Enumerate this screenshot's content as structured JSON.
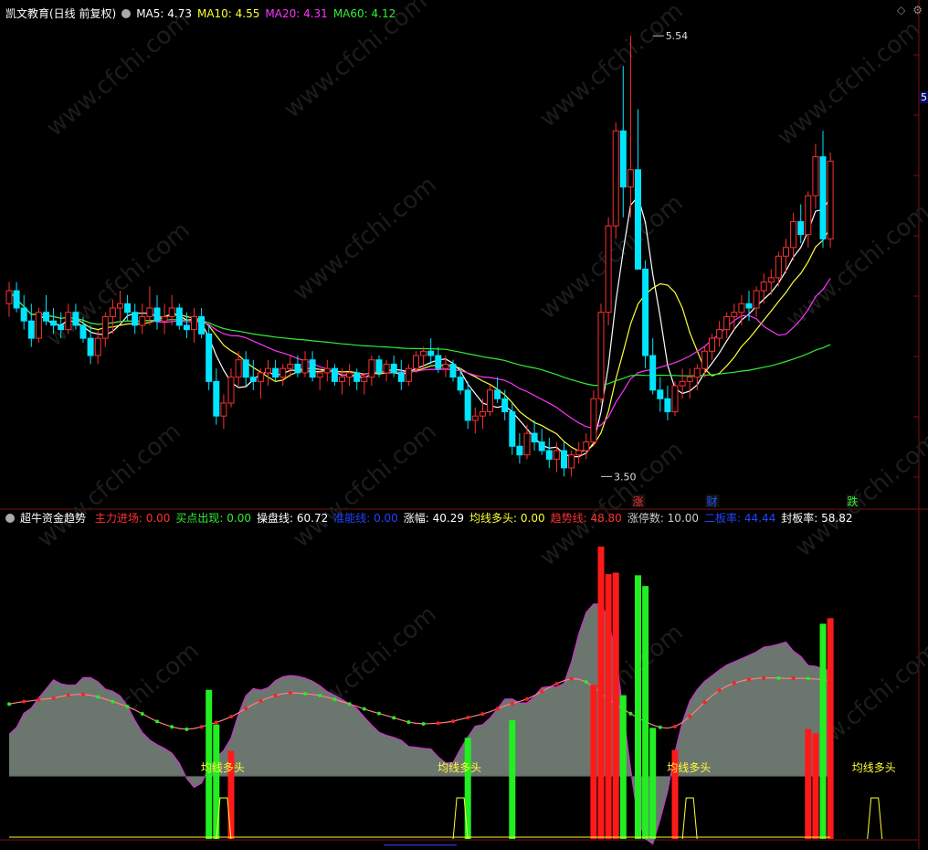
{
  "main_header": {
    "title": "凯文教育(日线 前复权)",
    "ma5_label": "MA5: 4.73",
    "ma10_label": "MA10: 4.55",
    "ma20_label": "MA20: 4.31",
    "ma60_label": "MA60: 4.12"
  },
  "indicator_header": {
    "name": "超牛资金趋势",
    "items": [
      {
        "text": "主力进场: 0.00",
        "color": "#ff3030"
      },
      {
        "text": "买点出现: 0.00",
        "color": "#33ee33"
      },
      {
        "text": "操盘线: 60.72",
        "color": "#ffffff"
      },
      {
        "text": "准能线: 0.00",
        "color": "#2244ff"
      },
      {
        "text": "涨幅: 40.29",
        "color": "#ffffff"
      },
      {
        "text": "均线多头: 0.00",
        "color": "#ffff33"
      },
      {
        "text": "趋势线: 48.80",
        "color": "#ff3030"
      },
      {
        "text": "涨停数: 10.00",
        "color": "#cccccc"
      },
      {
        "text": "二板率: 44.44",
        "color": "#2244ff"
      },
      {
        "text": "封板率: 58.82",
        "color": "#ffffff"
      }
    ]
  },
  "corner_icons": [
    "diamond-icon",
    "gear-icon"
  ],
  "edge_label": "5",
  "watermark": "www.cfchi.com",
  "colors": {
    "up": "#ff3030",
    "down": "#00e5ff",
    "ma5": "#ffffff",
    "ma10": "#ffff33",
    "ma20": "#ff33ff",
    "ma60": "#33ee33",
    "area": "#6b766f"
  },
  "chart_data": [
    {
      "type": "candlestick",
      "title": "凯文教育(日线 前复权)",
      "y_range": [
        3.4,
        5.6
      ],
      "annotations": [
        {
          "label": "5.54",
          "x_index": 87,
          "y": 5.54,
          "kind": "high"
        },
        {
          "label": "3.50",
          "x_index": 80,
          "y": 3.5,
          "kind": "low"
        }
      ],
      "event_markers": [
        {
          "label": "涨",
          "x_index": 85,
          "color": "#ff3030"
        },
        {
          "label": "财",
          "x_index": 95,
          "color": "#2255ff"
        },
        {
          "label": "跌",
          "x_index": 114,
          "color": "#33ee33"
        }
      ],
      "ohlc": [
        [
          4.3,
          4.4,
          4.24,
          4.36
        ],
        [
          4.36,
          4.4,
          4.26,
          4.28
        ],
        [
          4.28,
          4.34,
          4.18,
          4.22
        ],
        [
          4.22,
          4.3,
          4.1,
          4.14
        ],
        [
          4.14,
          4.28,
          4.12,
          4.26
        ],
        [
          4.26,
          4.34,
          4.2,
          4.22
        ],
        [
          4.22,
          4.28,
          4.16,
          4.2
        ],
        [
          4.2,
          4.26,
          4.14,
          4.18
        ],
        [
          4.18,
          4.3,
          4.16,
          4.26
        ],
        [
          4.26,
          4.3,
          4.18,
          4.2
        ],
        [
          4.2,
          4.24,
          4.12,
          4.14
        ],
        [
          4.14,
          4.2,
          4.02,
          4.06
        ],
        [
          4.06,
          4.18,
          4.02,
          4.14
        ],
        [
          4.14,
          4.26,
          4.1,
          4.24
        ],
        [
          4.24,
          4.32,
          4.16,
          4.28
        ],
        [
          4.28,
          4.36,
          4.22,
          4.3
        ],
        [
          4.3,
          4.34,
          4.22,
          4.26
        ],
        [
          4.26,
          4.3,
          4.16,
          4.2
        ],
        [
          4.2,
          4.3,
          4.16,
          4.24
        ],
        [
          4.24,
          4.38,
          4.2,
          4.28
        ],
        [
          4.28,
          4.34,
          4.18,
          4.22
        ],
        [
          4.22,
          4.3,
          4.16,
          4.24
        ],
        [
          4.24,
          4.34,
          4.2,
          4.28
        ],
        [
          4.28,
          4.3,
          4.18,
          4.2
        ],
        [
          4.2,
          4.26,
          4.14,
          4.18
        ],
        [
          4.18,
          4.28,
          4.12,
          4.24
        ],
        [
          4.24,
          4.28,
          4.14,
          4.16
        ],
        [
          4.16,
          4.2,
          3.9,
          3.94
        ],
        [
          3.94,
          4.0,
          3.74,
          3.78
        ],
        [
          3.78,
          3.88,
          3.72,
          3.84
        ],
        [
          3.84,
          4.0,
          3.82,
          3.96
        ],
        [
          3.96,
          4.08,
          3.92,
          4.04
        ],
        [
          4.04,
          4.08,
          3.92,
          3.96
        ],
        [
          3.96,
          4.04,
          3.9,
          3.94
        ],
        [
          3.94,
          4.0,
          3.86,
          3.98
        ],
        [
          3.98,
          4.04,
          3.92,
          4.0
        ],
        [
          4.0,
          4.04,
          3.94,
          3.96
        ],
        [
          3.96,
          4.02,
          3.92,
          4.0
        ],
        [
          4.0,
          4.06,
          3.96,
          4.02
        ],
        [
          4.02,
          4.06,
          3.96,
          3.98
        ],
        [
          3.98,
          4.08,
          3.96,
          4.04
        ],
        [
          4.04,
          4.08,
          3.94,
          3.96
        ],
        [
          3.96,
          4.0,
          3.9,
          3.98
        ],
        [
          3.98,
          4.04,
          3.94,
          4.0
        ],
        [
          4.0,
          4.02,
          3.92,
          3.94
        ],
        [
          3.94,
          4.0,
          3.88,
          3.96
        ],
        [
          3.96,
          4.02,
          3.92,
          3.98
        ],
        [
          3.98,
          4.0,
          3.9,
          3.94
        ],
        [
          3.94,
          3.98,
          3.88,
          3.96
        ],
        [
          3.96,
          4.06,
          3.92,
          4.04
        ],
        [
          4.04,
          4.06,
          3.96,
          3.98
        ],
        [
          3.98,
          4.04,
          3.94,
          4.02
        ],
        [
          4.02,
          4.06,
          3.96,
          3.98
        ],
        [
          3.98,
          4.04,
          3.9,
          3.94
        ],
        [
          3.94,
          4.02,
          3.92,
          4.0
        ],
        [
          4.0,
          4.08,
          3.98,
          4.06
        ],
        [
          4.06,
          4.1,
          4.0,
          4.08
        ],
        [
          4.08,
          4.14,
          4.02,
          4.06
        ],
        [
          4.06,
          4.1,
          3.98,
          4.0
        ],
        [
          4.0,
          4.06,
          3.96,
          4.02
        ],
        [
          4.02,
          4.04,
          3.94,
          3.96
        ],
        [
          3.96,
          4.0,
          3.88,
          3.9
        ],
        [
          3.9,
          3.94,
          3.72,
          3.76
        ],
        [
          3.76,
          3.82,
          3.7,
          3.78
        ],
        [
          3.78,
          3.86,
          3.72,
          3.8
        ],
        [
          3.8,
          3.92,
          3.78,
          3.9
        ],
        [
          3.9,
          3.96,
          3.84,
          3.86
        ],
        [
          3.86,
          3.9,
          3.76,
          3.8
        ],
        [
          3.8,
          3.84,
          3.6,
          3.64
        ],
        [
          3.64,
          3.7,
          3.56,
          3.6
        ],
        [
          3.6,
          3.74,
          3.58,
          3.7
        ],
        [
          3.7,
          3.76,
          3.62,
          3.66
        ],
        [
          3.66,
          3.72,
          3.6,
          3.62
        ],
        [
          3.62,
          3.68,
          3.54,
          3.58
        ],
        [
          3.58,
          3.66,
          3.52,
          3.62
        ],
        [
          3.62,
          3.66,
          3.5,
          3.54
        ],
        [
          3.54,
          3.62,
          3.5,
          3.6
        ],
        [
          3.6,
          3.66,
          3.56,
          3.62
        ],
        [
          3.62,
          3.7,
          3.58,
          3.66
        ],
        [
          3.66,
          3.9,
          3.64,
          3.86
        ],
        [
          3.86,
          4.3,
          3.84,
          4.26
        ],
        [
          4.26,
          4.7,
          4.2,
          4.66
        ],
        [
          4.66,
          5.14,
          4.6,
          5.1
        ],
        [
          5.1,
          5.4,
          4.7,
          4.84
        ],
        [
          4.84,
          5.54,
          4.7,
          4.92
        ],
        [
          4.92,
          5.2,
          4.46,
          4.46
        ],
        [
          4.46,
          4.5,
          4.0,
          4.06
        ],
        [
          4.06,
          4.14,
          3.88,
          3.9
        ],
        [
          3.9,
          3.96,
          3.8,
          3.86
        ],
        [
          3.86,
          3.92,
          3.76,
          3.8
        ],
        [
          3.8,
          3.94,
          3.78,
          3.92
        ],
        [
          3.92,
          4.0,
          3.86,
          3.94
        ],
        [
          3.94,
          4.0,
          3.86,
          3.96
        ],
        [
          3.96,
          4.02,
          3.9,
          4.0
        ],
        [
          4.0,
          4.1,
          3.96,
          4.08
        ],
        [
          4.08,
          4.16,
          4.04,
          4.14
        ],
        [
          4.14,
          4.22,
          4.1,
          4.18
        ],
        [
          4.18,
          4.26,
          4.14,
          4.24
        ],
        [
          4.24,
          4.3,
          4.18,
          4.26
        ],
        [
          4.26,
          4.34,
          4.2,
          4.3
        ],
        [
          4.3,
          4.36,
          4.22,
          4.28
        ],
        [
          4.28,
          4.38,
          4.24,
          4.36
        ],
        [
          4.36,
          4.44,
          4.3,
          4.4
        ],
        [
          4.4,
          4.46,
          4.34,
          4.42
        ],
        [
          4.42,
          4.54,
          4.38,
          4.52
        ],
        [
          4.52,
          4.6,
          4.44,
          4.56
        ],
        [
          4.56,
          4.72,
          4.5,
          4.68
        ],
        [
          4.68,
          4.76,
          4.58,
          4.62
        ],
        [
          4.62,
          4.82,
          4.56,
          4.8
        ],
        [
          4.8,
          5.04,
          4.74,
          4.98
        ],
        [
          4.98,
          5.1,
          4.56,
          4.6
        ],
        [
          4.6,
          5.0,
          4.56,
          4.96
        ]
      ]
    },
    {
      "type": "indicator",
      "title": "超牛资金趋势",
      "y_range": [
        0,
        100
      ],
      "labels": [
        {
          "text": "均线多头",
          "x_index": 29
        },
        {
          "text": "均线多头",
          "x_index": 61
        },
        {
          "text": "均线多头",
          "x_index": 92
        },
        {
          "text": "均线多头",
          "x_index": 117
        }
      ]
    }
  ]
}
